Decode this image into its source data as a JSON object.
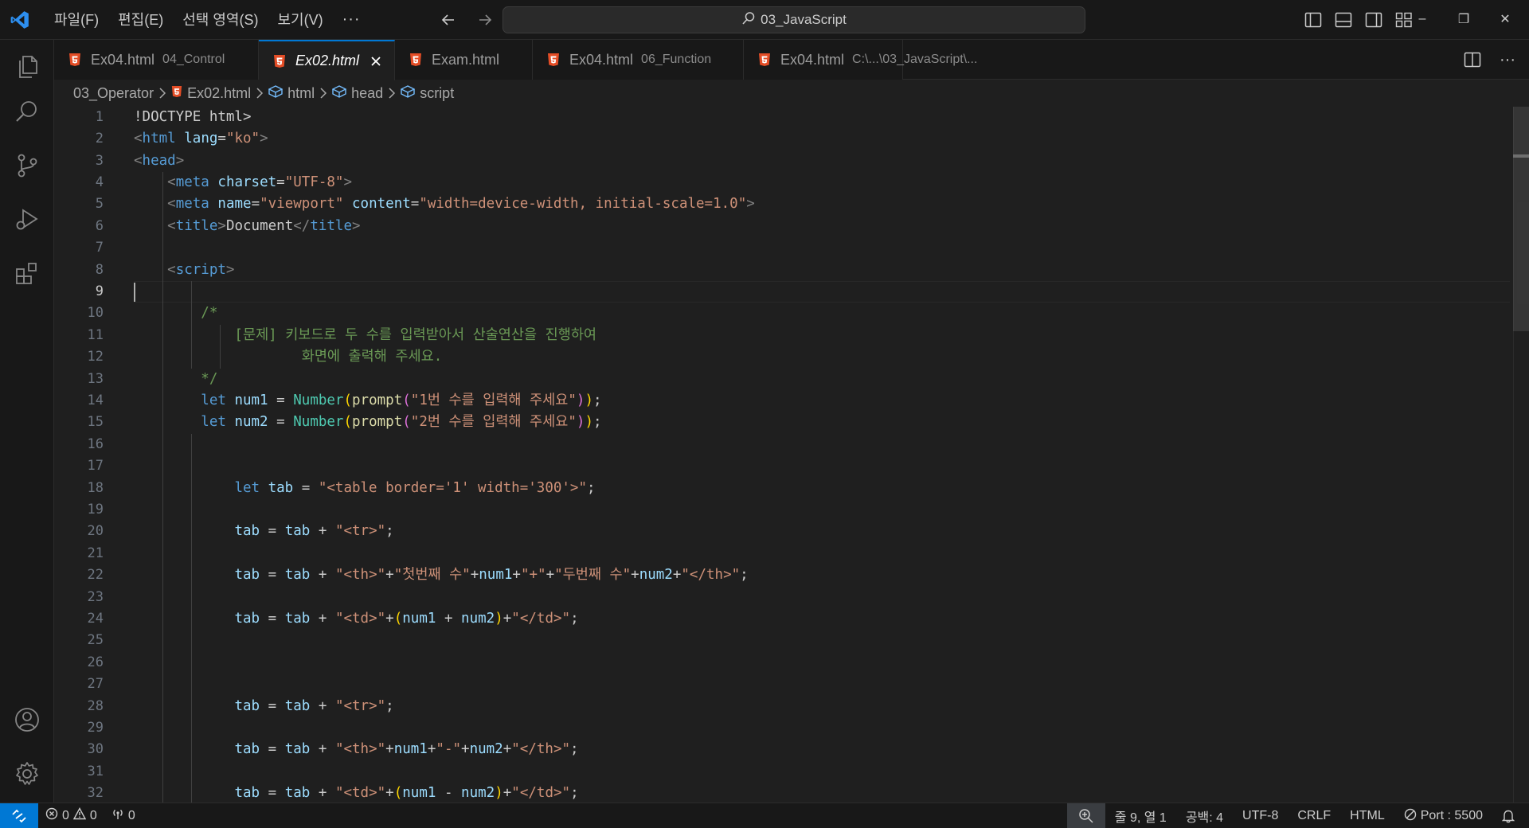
{
  "titlebar": {
    "menu": [
      "파일(F)",
      "편집(E)",
      "선택 영역(S)",
      "보기(V)"
    ],
    "more": "···",
    "search_text": "03_JavaScript",
    "win_minimize": "–",
    "win_restore": "❐",
    "win_close": "✕"
  },
  "tabs": [
    {
      "name": "Ex04.html",
      "desc": "04_Control",
      "active": false
    },
    {
      "name": "Ex02.html",
      "desc": "",
      "active": true
    },
    {
      "name": "Exam.html",
      "desc": "",
      "active": false
    },
    {
      "name": "Ex04.html",
      "desc": "06_Function",
      "active": false
    },
    {
      "name": "Ex04.html",
      "desc": "C:\\...\\03_JavaScript\\...",
      "active": false
    }
  ],
  "breadcrumb": [
    "03_Operator",
    "Ex02.html",
    "html",
    "head",
    "script"
  ],
  "editor": {
    "current_line": 9,
    "line_numbers": [
      "1",
      "2",
      "3",
      "4",
      "5",
      "6",
      "7",
      "8",
      "9",
      "10",
      "11",
      "12",
      "13",
      "14",
      "15",
      "16",
      "17",
      "18",
      "19",
      "20",
      "21",
      "22",
      "23",
      "24",
      "25",
      "26",
      "27",
      "28",
      "29",
      "30",
      "31",
      "32"
    ],
    "lines": [
      "<!DOCTYPE html>",
      "<html lang=\"ko\">",
      "<head>",
      "    <meta charset=\"UTF-8\">",
      "    <meta name=\"viewport\" content=\"width=device-width, initial-scale=1.0\">",
      "    <title>Document</title>",
      "",
      "    <script>",
      "",
      "        /*",
      "            [문제] 키보드로 두 수를 입력받아서 산술연산을 진행하여",
      "                    화면에 출력해 주세요.",
      "        */",
      "        let num1 = Number(prompt(\"1번 수를 입력해 주세요\"));",
      "        let num2 = Number(prompt(\"2번 수를 입력해 주세요\"));",
      "",
      "",
      "            let tab = \"<table border='1' width='300'>\";",
      "",
      "            tab = tab + \"<tr>\";",
      "",
      "            tab = tab + \"<th>\"+\"첫번째 수\"+num1+\"+\"+\"두번째 수\"+num2+\"</th>\";",
      "",
      "            tab = tab + \"<td>\"+(num1 + num2)+\"</td>\";",
      "",
      "",
      "",
      "            tab = tab + \"<tr>\";",
      "",
      "            tab = tab + \"<th>\"+num1+\"-\"+num2+\"</th>\";",
      "",
      "            tab = tab + \"<td>\"+(num1 - num2)+\"</td>\";"
    ]
  },
  "statusbar": {
    "errors": "0",
    "warnings": "0",
    "ports": "0",
    "position": "줄 9, 열 1",
    "spaces": "공백: 4",
    "encoding": "UTF-8",
    "eol": "CRLF",
    "language": "HTML",
    "port": "Port : 5500"
  },
  "colors": {
    "accent": "#0078d4",
    "html_icon": "#e44d26",
    "background": "#1f1f1f"
  }
}
